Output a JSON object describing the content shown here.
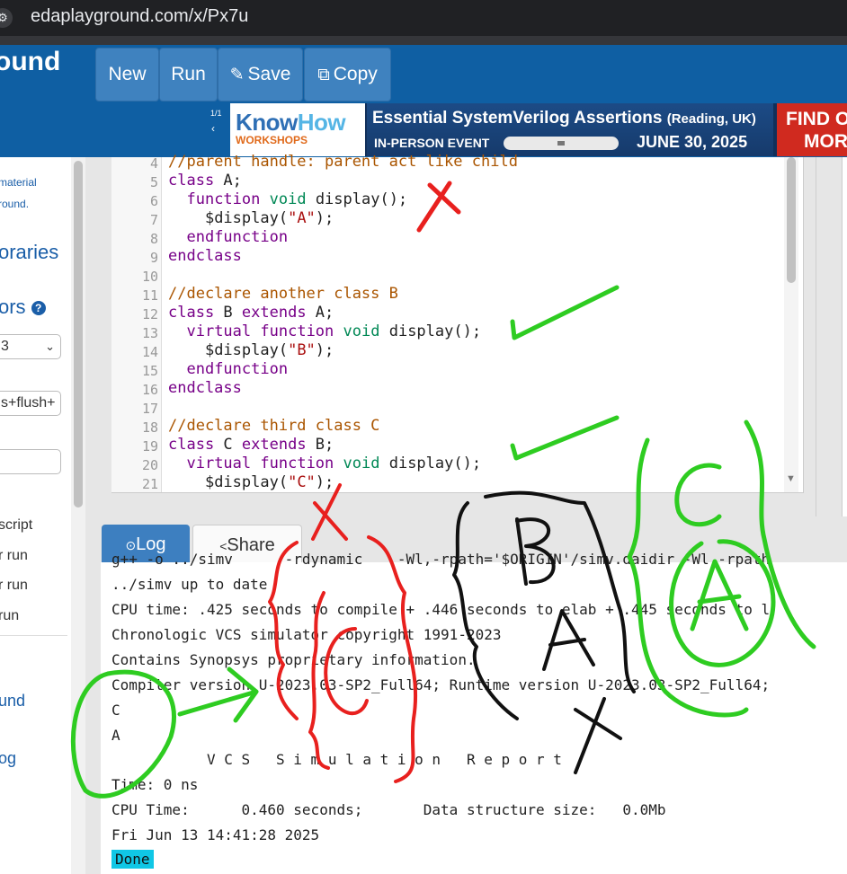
{
  "browser": {
    "url": "edaplayground.com/x/Px7u"
  },
  "header": {
    "brand": "ound",
    "buttons": {
      "new": "New",
      "run": "Run",
      "save": "Save",
      "copy": "Copy"
    },
    "pager": "1/1",
    "pager_arrow": "‹"
  },
  "banner": {
    "logo_main": "Know",
    "logo_accent": "How",
    "logo_sub": "WORKSHOPS",
    "title": "Essential SystemVerilog Assertions",
    "title_sub": "(Reading, UK)",
    "event": "IN-PERSON EVENT",
    "date": "JUNE 30, 2025",
    "cta_line1": "FIND O",
    "cta_line2": "MOR"
  },
  "left_panel": {
    "frag1": "material",
    "frag2": "round.",
    "libraries": "oraries",
    "editors": "ors",
    "select_value": "3",
    "options_value": "s+flush+",
    "script": "script",
    "run1": "r run",
    "run2": "r run",
    "run3": "run",
    "link1": "und",
    "link2": "og"
  },
  "editor": {
    "line_numbers": [
      "4",
      "5",
      "6",
      "7",
      "8",
      "9",
      "10",
      "11",
      "12",
      "13",
      "14",
      "15",
      "16",
      "17",
      "18",
      "19",
      "20",
      "21"
    ],
    "lines": {
      "l4": "//parent handle: parent act like child",
      "l5_kw": "class",
      "l5_rest": " A;",
      "l6_kw": "function",
      "l6_ty": "void",
      "l6_rest": " display();",
      "l7_fn": "$display(",
      "l7_str": "\"A\"",
      "l7_end": ");",
      "l8_kw": "endfunction",
      "l9_kw": "endclass",
      "l11": "//declare another class B",
      "l12_kw": "class",
      "l12_mid": " B ",
      "l12_kw2": "extends",
      "l12_rest": " A;",
      "l13_kw": "virtual",
      "l13_kw2": "function",
      "l13_ty": "void",
      "l13_rest": " display();",
      "l14_fn": "$display(",
      "l14_str": "\"B\"",
      "l14_end": ");",
      "l15_kw": "endfunction",
      "l16_kw": "endclass",
      "l18": "//declare third class C",
      "l19_kw": "class",
      "l19_mid": " C ",
      "l19_kw2": "extends",
      "l19_rest": " B;",
      "l20_kw": "virtual",
      "l20_kw2": "function",
      "l20_ty": "void",
      "l20_rest": " display();",
      "l21_fn": "$display(",
      "l21_str": "\"C\"",
      "l21_end": ");"
    }
  },
  "tabs": {
    "log": "Log",
    "share": "Share"
  },
  "log": {
    "lines": [
      "g++ -o ../simv      -rdynamic    -Wl,-rpath='$ORIGIN'/simv.daidir -Wl,-rpath",
      "../simv up to date",
      "CPU time: .425 seconds to compile + .446 seconds to elab + .445 seconds to l",
      "Chronologic VCS simulator copyright 1991-2023",
      "Contains Synopsys proprietary information.",
      "Compiler version U-2023.03-SP2_Full64; Runtime version U-2023.03-SP2_Full64;",
      "C",
      "A",
      "           V C S   S i m u l a t i o n   R e p o r t",
      "Time: 0 ns",
      "CPU Time:      0.460 seconds;       Data structure size:   0.0Mb",
      "Fri Jun 13 14:41:28 2025"
    ],
    "status": "Done"
  },
  "annotations": {
    "letters": [
      "B",
      "A",
      "C",
      "A"
    ]
  }
}
